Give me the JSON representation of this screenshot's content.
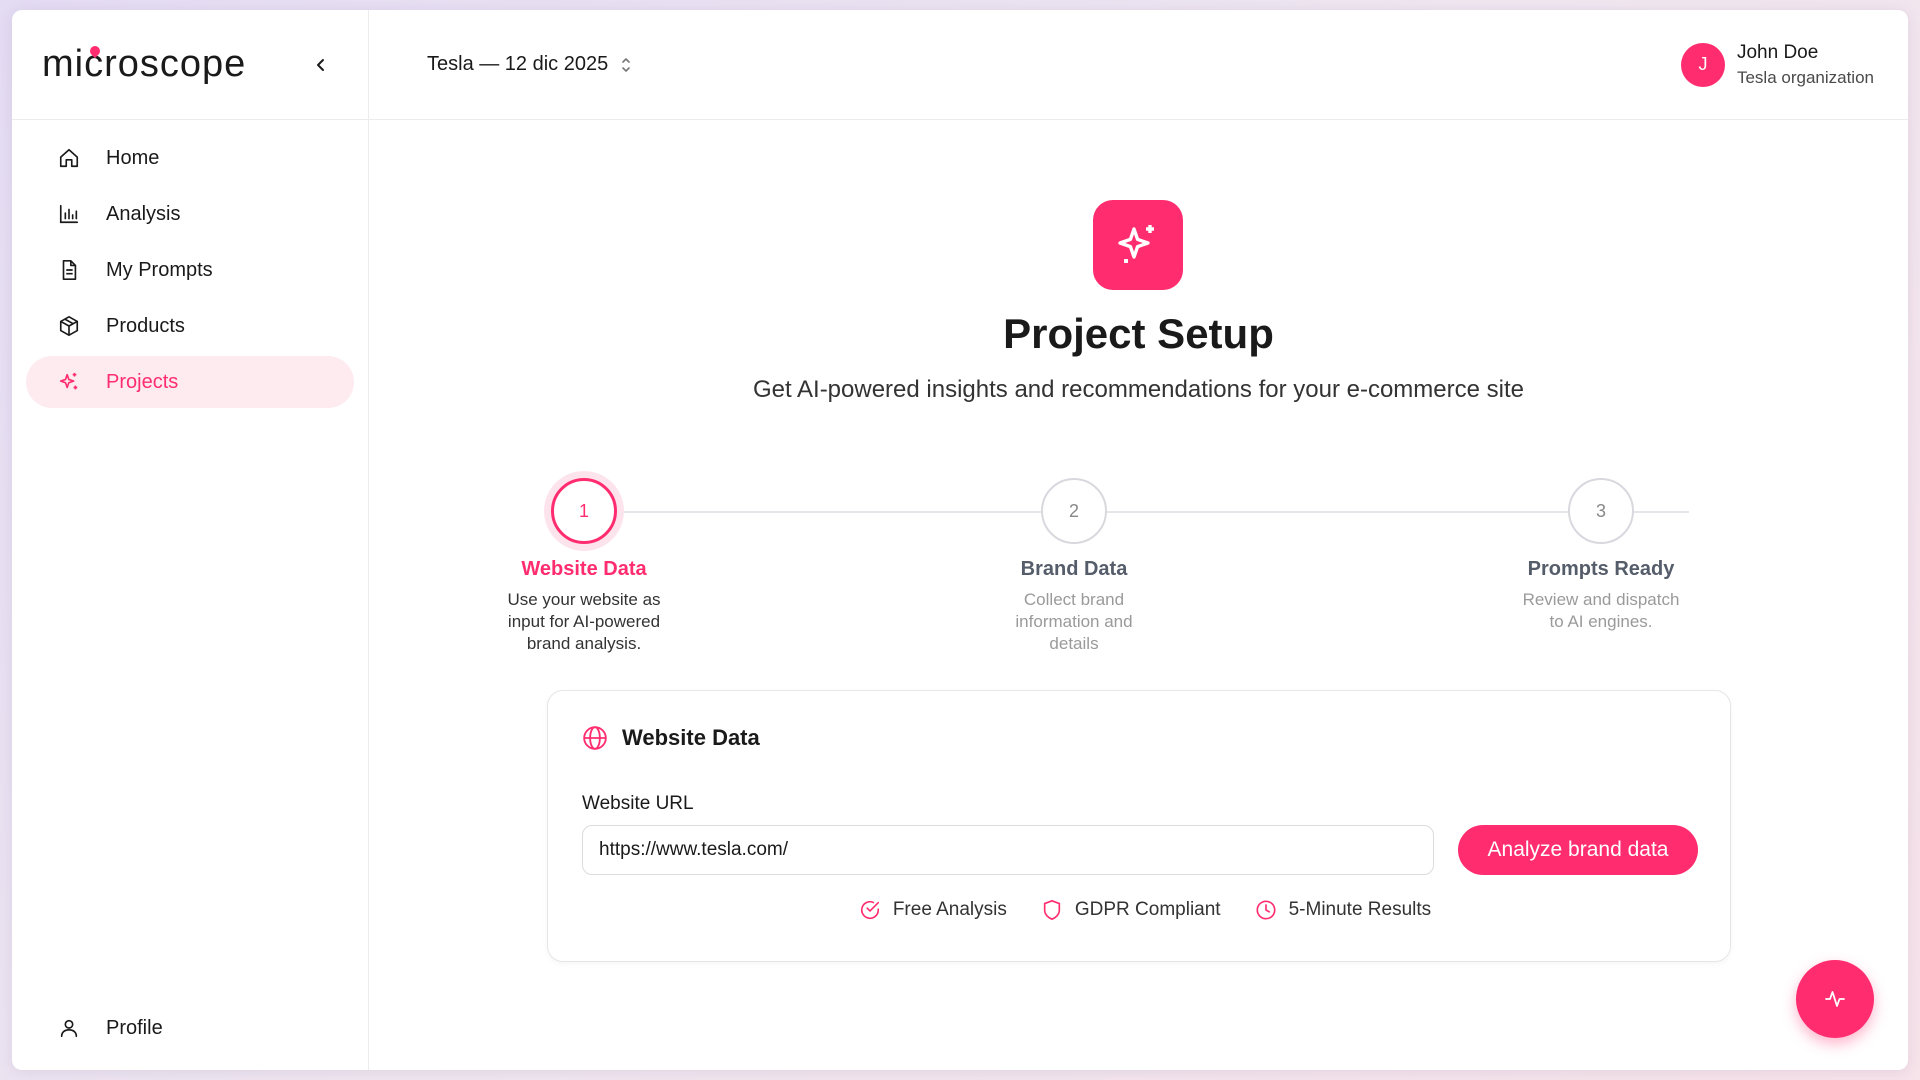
{
  "brand": {
    "logo_text": "microscope"
  },
  "colors": {
    "accent": "#ff2d6f",
    "accent_soft": "#fdebf0"
  },
  "sidebar": {
    "items": [
      {
        "label": "Home",
        "icon": "home-icon"
      },
      {
        "label": "Analysis",
        "icon": "bar-chart-icon"
      },
      {
        "label": "My Prompts",
        "icon": "document-icon"
      },
      {
        "label": "Products",
        "icon": "box-icon"
      },
      {
        "label": "Projects",
        "icon": "sparkles-icon",
        "active": true
      }
    ],
    "profile": {
      "label": "Profile",
      "icon": "user-icon"
    }
  },
  "header": {
    "project_selector": "Tesla — 12 dic 2025",
    "user": {
      "initial": "J",
      "name": "John Doe",
      "organization": "Tesla organization"
    }
  },
  "main": {
    "title": "Project Setup",
    "subtitle": "Get AI-powered insights and recommendations for your e-commerce site",
    "steps": [
      {
        "number": "1",
        "title": "Website Data",
        "description": "Use your website as input for AI-powered brand analysis.",
        "active": true
      },
      {
        "number": "2",
        "title": "Brand Data",
        "description": "Collect brand information and details",
        "active": false
      },
      {
        "number": "3",
        "title": "Prompts Ready",
        "description": "Review and dispatch to AI engines.",
        "active": false
      }
    ],
    "card": {
      "title": "Website Data",
      "field_label": "Website URL",
      "url_value": "https://www.tesla.com/",
      "button_label": "Analyze brand data",
      "features": [
        {
          "label": "Free Analysis",
          "icon": "check-circle-icon"
        },
        {
          "label": "GDPR Compliant",
          "icon": "shield-icon"
        },
        {
          "label": "5-Minute Results",
          "icon": "clock-icon"
        }
      ]
    }
  }
}
